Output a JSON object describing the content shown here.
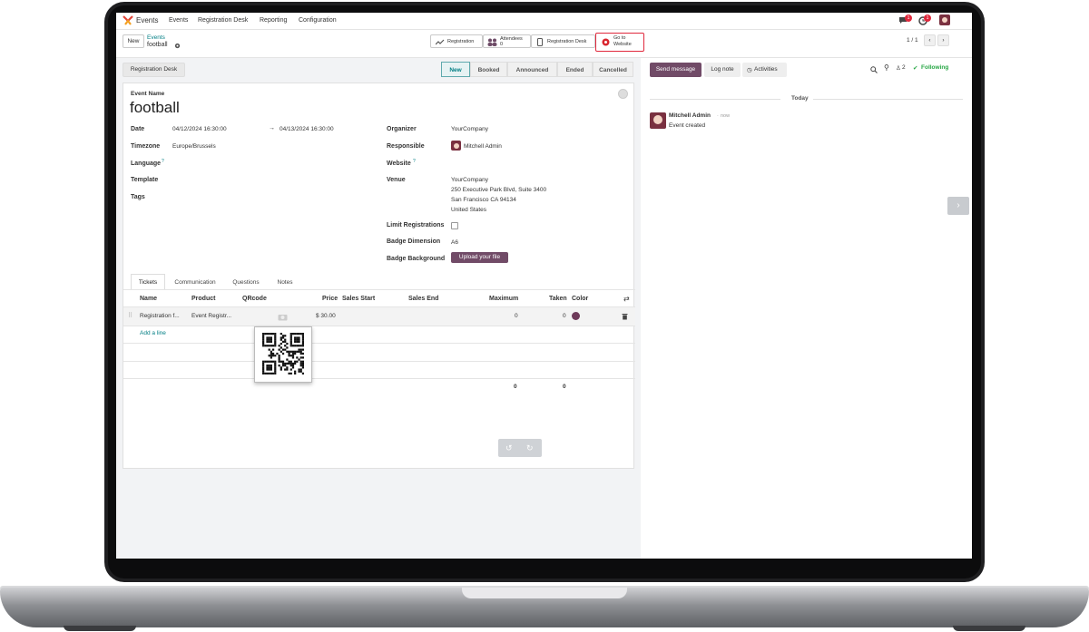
{
  "navbar": {
    "app_name": "Events",
    "menus": [
      "Events",
      "Registration Desk",
      "Reporting",
      "Configuration"
    ],
    "messages_badge": "1",
    "activities_badge": "1"
  },
  "control_panel": {
    "new_label": "New",
    "breadcrumb_parent": "Events",
    "breadcrumb_current": "football",
    "smart_buttons": {
      "registration": "Registration",
      "attendees_label": "Attendees",
      "attendees_count": "0",
      "registration_desk": "Registration Desk",
      "go_to_website_line1": "Go to",
      "go_to_website_line2": "Website"
    },
    "pager": "1 / 1"
  },
  "form": {
    "registration_desk_button": "Registration Desk",
    "statusbar": [
      "New",
      "Booked",
      "Announced",
      "Ended",
      "Cancelled"
    ],
    "active_stage": "New",
    "event_name_label": "Event Name",
    "event_name": "football",
    "left_fields": {
      "date_label": "Date",
      "date_start": "04/12/2024 16:30:00",
      "date_arrow": "→",
      "date_end": "04/13/2024 16:30:00",
      "timezone_label": "Timezone",
      "timezone": "Europe/Brussels",
      "language_label": "Language",
      "template_label": "Template",
      "tags_label": "Tags",
      "help_mark": "?"
    },
    "right_fields": {
      "organizer_label": "Organizer",
      "organizer": "YourCompany",
      "responsible_label": "Responsible",
      "responsible": "Mitchell Admin",
      "website_label": "Website",
      "venue_label": "Venue",
      "venue_lines": [
        "YourCompany",
        "250 Executive Park Blvd, Suite 3400",
        "San Francisco CA 94134",
        "United States"
      ],
      "limit_registrations_label": "Limit Registrations",
      "badge_dimension_label": "Badge Dimension",
      "badge_dimension": "A6",
      "badge_background_label": "Badge Background",
      "upload_button": "Upload your file"
    },
    "tabs": [
      "Tickets",
      "Communication",
      "Questions",
      "Notes"
    ],
    "active_tab": "Tickets",
    "ticket_table": {
      "columns": [
        "Name",
        "Product",
        "QRcode",
        "Price",
        "Sales Start",
        "Sales End",
        "Maximum",
        "Taken",
        "Color"
      ],
      "rows": [
        {
          "name": "Registration f...",
          "product": "Event Registr...",
          "price": "$ 30.00",
          "maximum": "0",
          "taken": "0",
          "color": "#6e3a5a"
        }
      ],
      "add_line": "Add a line",
      "totals": {
        "maximum": "0",
        "taken": "0"
      }
    }
  },
  "chatter": {
    "send_message": "Send message",
    "log_note": "Log note",
    "activities": "Activities",
    "followers_count": "2",
    "following": "Following",
    "date_separator": "Today",
    "message_author": "Mitchell Admin",
    "message_time": "now",
    "message_body": "Event created"
  },
  "colors": {
    "brand": "#714b67",
    "accent": "#017e84",
    "following": "#28a745",
    "highlight_border": "#e0283c"
  }
}
